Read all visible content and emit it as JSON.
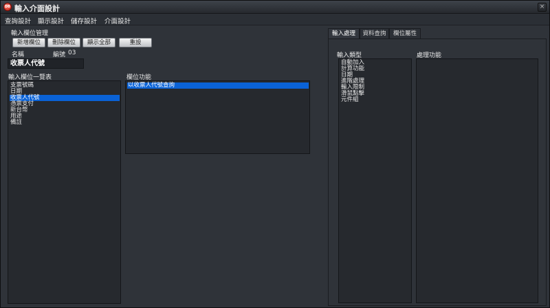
{
  "window": {
    "title": "輸入介面設計",
    "app_icon": "DB",
    "close_glyph": "×"
  },
  "menu": [
    "查詢設計",
    "顯示設計",
    "儲存設計",
    "介面設計"
  ],
  "field_mgmt": {
    "group_label": "輸入欄位管理",
    "buttons": [
      "新增欄位",
      "刪除欄位",
      "顯示全部",
      "重設"
    ],
    "name_label": "名稱",
    "code_label": "編號",
    "code_value": "03",
    "name_value": "收票人代號"
  },
  "field_list": {
    "label": "輸入欄位一覽表",
    "items": [
      "支票號碼",
      "日期",
      "收票人代號",
      "憑票支付",
      "新台幣",
      "用途",
      "備註"
    ],
    "selected_index": 2
  },
  "field_function": {
    "label": "欄位功能",
    "items": [
      "以收票人代號查詢"
    ],
    "selected_index": 0
  },
  "tabs": {
    "items": [
      "輸入處理",
      "資料查詢",
      "欄位屬性"
    ],
    "active_index": 0
  },
  "input_type": {
    "label": "輸入類型",
    "items": [
      "自動加入",
      "計算功能",
      "日期",
      "進階處理",
      "輸入限制",
      "滑鼠點擊",
      "元件組"
    ]
  },
  "process_function": {
    "label": "處理功能"
  },
  "colors": {
    "selection": "#0a62d6",
    "window_bg": "#2f3339",
    "list_bg": "#26292e"
  }
}
